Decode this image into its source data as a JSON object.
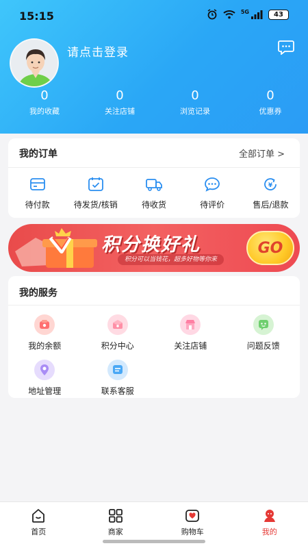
{
  "status": {
    "time": "15:15",
    "battery": "43",
    "network": "5G"
  },
  "profile": {
    "login_text": "请点击登录"
  },
  "stats": [
    {
      "value": "0",
      "label": "我的收藏"
    },
    {
      "value": "0",
      "label": "关注店铺"
    },
    {
      "value": "0",
      "label": "浏览记录"
    },
    {
      "value": "0",
      "label": "优惠券"
    }
  ],
  "orders": {
    "title": "我的订单",
    "all_label": "全部订单 >",
    "items": [
      {
        "label": "待付款",
        "icon": "wallet-icon"
      },
      {
        "label": "待发货/核销",
        "icon": "calendar-check-icon"
      },
      {
        "label": "待收货",
        "icon": "truck-icon"
      },
      {
        "label": "待评价",
        "icon": "comment-icon"
      },
      {
        "label": "售后/退款",
        "icon": "refund-icon"
      }
    ]
  },
  "banner": {
    "title": "积分换好礼",
    "subtitle": "积分可以当钱花，超多好物等你来",
    "button": "GO"
  },
  "services": {
    "title": "我的服务",
    "items": [
      {
        "label": "我的余额",
        "icon": "balance-icon",
        "color": "#ff6f6f"
      },
      {
        "label": "积分中心",
        "icon": "points-icon",
        "color": "#ff8fa6"
      },
      {
        "label": "关注店铺",
        "icon": "store-icon",
        "color": "#ff7fa3"
      },
      {
        "label": "问题反馈",
        "icon": "feedback-icon",
        "color": "#6fcf6f"
      },
      {
        "label": "地址管理",
        "icon": "location-icon",
        "color": "#a98cf5"
      },
      {
        "label": "联系客服",
        "icon": "customer-service-icon",
        "color": "#4aa8f5"
      }
    ]
  },
  "tabs": [
    {
      "label": "首页",
      "icon": "home-icon"
    },
    {
      "label": "商家",
      "icon": "grid-icon"
    },
    {
      "label": "购物车",
      "icon": "cart-heart-icon"
    },
    {
      "label": "我的",
      "icon": "profile-icon",
      "active": true
    }
  ],
  "colors": {
    "header": "#2aa7f6",
    "accent_red": "#e53935",
    "icon_blue": "#2a8ef0"
  }
}
